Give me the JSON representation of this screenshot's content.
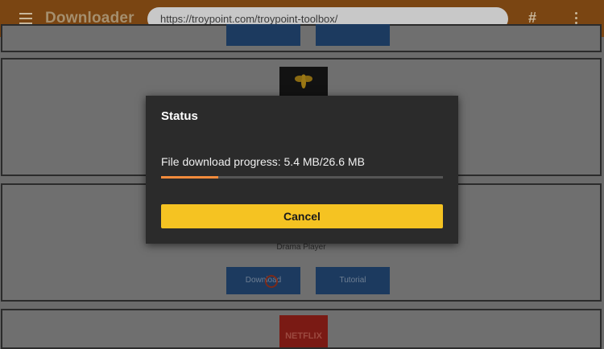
{
  "appbar": {
    "title": "Downloader",
    "url_value": "https://troypoint.com/troypoint-toolbox/",
    "menu_icon": "hamburger-menu-icon",
    "bookmark_icon": "hash-icon",
    "overflow_icon": "more-vert-icon"
  },
  "list": {
    "items": [
      {
        "icon": "blank"
      },
      {
        "icon": "bee-logo-icon"
      },
      {
        "name": "Drama Player",
        "download_label": "Download",
        "tutorial_label": "Tutorial"
      },
      {
        "icon": "netflix-logo",
        "logo_text": "NETFLIX"
      }
    ]
  },
  "dialog": {
    "title": "Status",
    "progress_text": "File download progress: 5.4 MB/26.6 MB",
    "progress_fraction": 0.203,
    "cancel_label": "Cancel"
  },
  "colors": {
    "appbar": "#7a4512",
    "accent_yellow": "#f5c322",
    "progress_orange": "#f28b3c",
    "dialog_bg": "#2b2b2b"
  }
}
